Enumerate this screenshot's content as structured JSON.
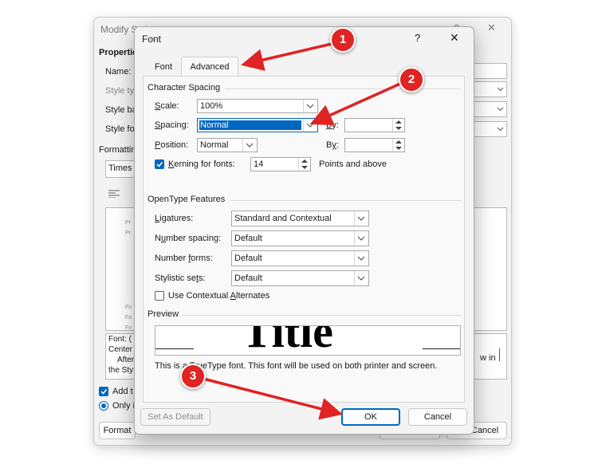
{
  "background_dialog": {
    "title": "Modify Style",
    "properties_label": "Properties",
    "name_label": "Name:",
    "style_type_label": "Style type:",
    "style_based_label": "Style based on:",
    "style_following_label": "Style for following paragraph:",
    "formatting_label": "Formatting",
    "font_name": "Times",
    "preview_lines": [
      "Pr",
      "Pr",
      "Fo",
      "Fo",
      "Fo"
    ],
    "description_lines": [
      "Font: (",
      "Center",
      "After",
      "the Sty"
    ],
    "show_in_text": "w in",
    "add_to_label": "Add t",
    "only_label": "Only i",
    "format_button": "Format",
    "ok_partial": "OK",
    "cancel_partial": "Cancel"
  },
  "font_dialog": {
    "title": "Font",
    "help_glyph": "?",
    "close_glyph": "✕",
    "tabs": [
      {
        "label": "Font",
        "active": false
      },
      {
        "label": "Advanced",
        "active": true
      }
    ],
    "character_spacing": {
      "heading": "Character Spacing",
      "scale_label": "Scale:",
      "scale_value": "100%",
      "spacing_label": "Spacing:",
      "spacing_value": "Normal",
      "by_label": "By:",
      "by_value": "",
      "position_label": "Position:",
      "position_value": "Normal",
      "position_by_label": "By:",
      "position_by_value": "",
      "kerning_label": "Kerning for fonts:",
      "kerning_checked": true,
      "kerning_value": "14",
      "kerning_suffix": "Points and above"
    },
    "opentype": {
      "heading": "OpenType Features",
      "ligatures_label": "Ligatures:",
      "ligatures_value": "Standard and Contextual",
      "number_spacing_label": "Number spacing:",
      "number_spacing_value": "Default",
      "number_forms_label": "Number forms:",
      "number_forms_value": "Default",
      "stylistic_sets_label": "Stylistic sets:",
      "stylistic_sets_value": "Default",
      "contextual_alternates_label": "Use Contextual Alternates",
      "contextual_alternates_checked": false
    },
    "preview": {
      "heading": "Preview",
      "sample_text": "Title",
      "note": "This is a TrueType font. This font will be used on both printer and screen."
    },
    "buttons": {
      "set_default": "Set As Default",
      "ok": "OK",
      "cancel": "Cancel"
    }
  },
  "annotations": {
    "badges": [
      "1",
      "2",
      "3"
    ],
    "color": "#e02323"
  }
}
